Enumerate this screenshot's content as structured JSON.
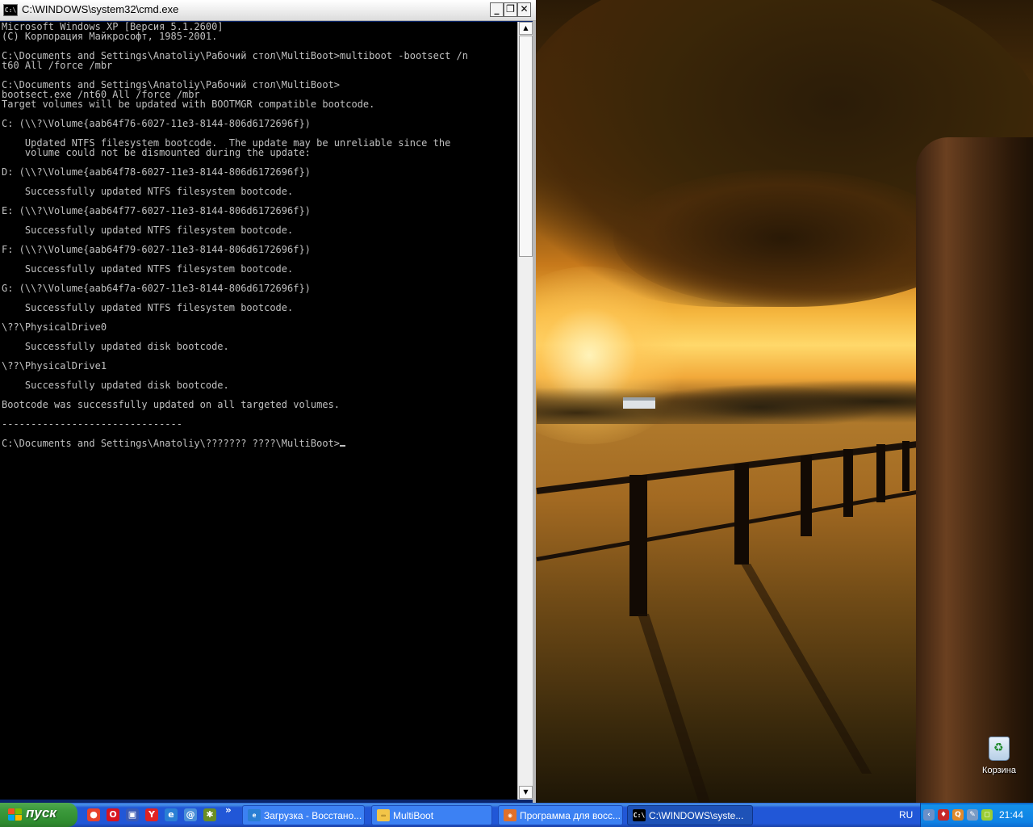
{
  "window": {
    "title": "C:\\WINDOWS\\system32\\cmd.exe",
    "icon": "C:\\",
    "minimize": "_",
    "restore": "❐",
    "close": "✕"
  },
  "console": {
    "lines": [
      "Microsoft Windows XP [Версия 5.1.2600]",
      "(С) Корпорация Майкрософт, 1985-2001.",
      "",
      "C:\\Documents and Settings\\Anatoliy\\Рабочий стол\\MultiBoot>multiboot -bootsect /n",
      "t60 All /force /mbr",
      "",
      "C:\\Documents and Settings\\Anatoliy\\Рабочий стол\\MultiBoot>",
      "bootsect.exe /nt60 All /force /mbr",
      "Target volumes will be updated with BOOTMGR compatible bootcode.",
      "",
      "C: (\\\\?\\Volume{aab64f76-6027-11e3-8144-806d6172696f})",
      "",
      "    Updated NTFS filesystem bootcode.  The update may be unreliable since the",
      "    volume could not be dismounted during the update:",
      "",
      "D: (\\\\?\\Volume{aab64f78-6027-11e3-8144-806d6172696f})",
      "",
      "    Successfully updated NTFS filesystem bootcode.",
      "",
      "E: (\\\\?\\Volume{aab64f77-6027-11e3-8144-806d6172696f})",
      "",
      "    Successfully updated NTFS filesystem bootcode.",
      "",
      "F: (\\\\?\\Volume{aab64f79-6027-11e3-8144-806d6172696f})",
      "",
      "    Successfully updated NTFS filesystem bootcode.",
      "",
      "G: (\\\\?\\Volume{aab64f7a-6027-11e3-8144-806d6172696f})",
      "",
      "    Successfully updated NTFS filesystem bootcode.",
      "",
      "\\??\\PhysicalDrive0",
      "",
      "    Successfully updated disk bootcode.",
      "",
      "\\??\\PhysicalDrive1",
      "",
      "    Successfully updated disk bootcode.",
      "",
      "Bootcode was successfully updated on all targeted volumes.",
      "",
      "-------------------------------",
      "",
      "C:\\Documents and Settings\\Anatoliy\\??????? ????\\MultiBoot>"
    ],
    "colors": {
      "background": "#000000",
      "text": "#c0c0c0"
    }
  },
  "scrollbar": {
    "up": "▲",
    "down": "▼"
  },
  "desktop": {
    "icons": [
      {
        "label": "Корзина",
        "icon": "recycle-bin-icon"
      }
    ]
  },
  "taskbar": {
    "start_label": "пуск",
    "quick_launch_more": "»",
    "quick_launch": [
      {
        "icon": "chrome-icon",
        "glyph": "●"
      },
      {
        "icon": "opera-icon",
        "glyph": "O"
      },
      {
        "icon": "floppy-save-icon",
        "glyph": "▣"
      },
      {
        "icon": "yandex-browser-icon",
        "glyph": "Y"
      },
      {
        "icon": "internet-explorer-icon",
        "glyph": "e"
      },
      {
        "icon": "mail-icon",
        "glyph": "@"
      },
      {
        "icon": "bug-icon",
        "glyph": "✱"
      }
    ],
    "tasks": [
      {
        "label": "Загрузка - Восстано...",
        "icon": "ie-page-icon",
        "glyph": "e"
      },
      {
        "label": "MultiBoot",
        "icon": "folder-icon",
        "glyph": "▭"
      },
      {
        "label": "Программа для восс...",
        "icon": "firefox-icon",
        "glyph": "◉"
      },
      {
        "label": "C:\\WINDOWS\\syste...",
        "icon": "cmd-icon",
        "glyph": "C:\\"
      }
    ],
    "language": "RU",
    "tray": [
      {
        "icon": "tray-arrow-icon",
        "glyph": "‹"
      },
      {
        "icon": "antivirus-shield-icon",
        "glyph": "♦"
      },
      {
        "icon": "tray-app-icon",
        "glyph": "Q"
      },
      {
        "icon": "tray-edit-icon",
        "glyph": "✎"
      },
      {
        "icon": "tray-window-icon",
        "glyph": "◻"
      }
    ],
    "clock": "21:44"
  },
  "colors": {
    "taskbar": "#2157d7",
    "start_button": "#3c9a3c",
    "titlebar": "#f2f2f2"
  }
}
